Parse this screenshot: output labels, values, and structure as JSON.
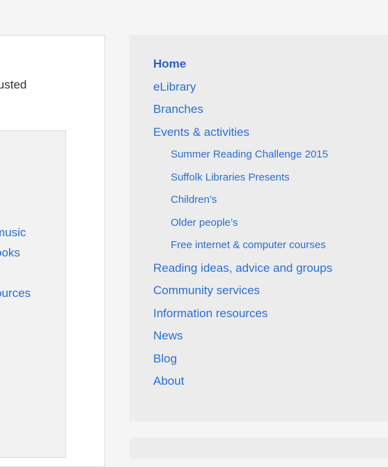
{
  "main": {
    "partial_text": "justed",
    "links": [
      "music",
      "ooks",
      "ources"
    ]
  },
  "sidebar": {
    "items": [
      {
        "label": "Home",
        "active": true
      },
      {
        "label": "eLibrary"
      },
      {
        "label": "Branches"
      },
      {
        "label": "Events & activities"
      },
      {
        "label": "Summer Reading Challenge 2015",
        "sub": true
      },
      {
        "label": "Suffolk Libraries Presents",
        "sub": true
      },
      {
        "label": "Children’s",
        "sub": true
      },
      {
        "label": "Older people’s",
        "sub": true
      },
      {
        "label": "Free internet & computer courses",
        "sub": true
      },
      {
        "label": "Reading ideas, advice and groups"
      },
      {
        "label": "Community services"
      },
      {
        "label": "Information resources"
      },
      {
        "label": "News"
      },
      {
        "label": "Blog"
      },
      {
        "label": "About"
      }
    ]
  },
  "colors": {
    "link": "#2a6fd1",
    "sidebar_bg": "#ececec",
    "page_bg": "#f5f5f5"
  }
}
